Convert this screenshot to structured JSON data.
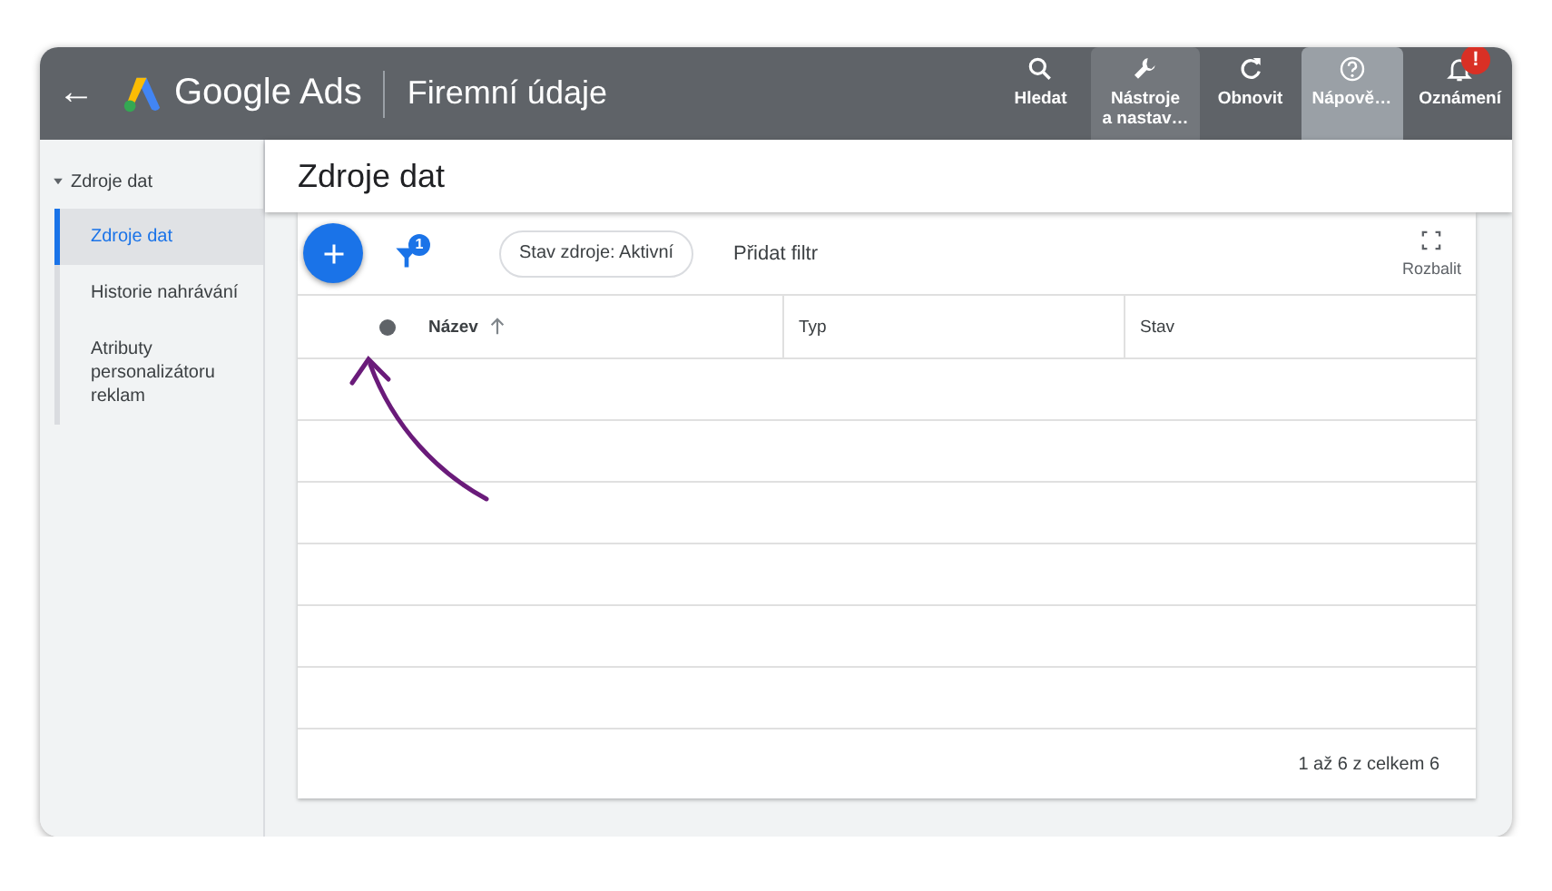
{
  "app_bar": {
    "back": "←",
    "product": "Google Ads",
    "section": "Firemní údaje",
    "actions": [
      {
        "label": "Hledat",
        "selected": false,
        "hovered": false
      },
      {
        "label": "Nástroje\na nastav…",
        "selected": false,
        "hovered": true
      },
      {
        "label": "Obnovit",
        "selected": false,
        "hovered": false
      },
      {
        "label": "Nápově…",
        "selected": true,
        "hovered": false
      },
      {
        "label": "Oznámení",
        "selected": false,
        "hovered": false,
        "badge": "!"
      }
    ]
  },
  "sidebar": {
    "group": {
      "label": "Zdroje dat",
      "expanded": true
    },
    "items": [
      {
        "label": "Zdroje dat",
        "selected": true
      },
      {
        "label": "Historie nahrávání",
        "selected": false
      },
      {
        "label": "Atributy personalizátoru reklam",
        "selected": false
      }
    ]
  },
  "page_title": "Zdroje dat",
  "toolbar": {
    "filter_count": "1",
    "chip": "Stav zdroje: Aktivní",
    "add_filter": "Přidat filtr",
    "expand": "Rozbalit"
  },
  "table": {
    "columns": [
      {
        "label": "Název",
        "sorted": true
      },
      {
        "label": "Typ",
        "sorted": false
      },
      {
        "label": "Stav",
        "sorted": false
      }
    ],
    "pagination": "1 až 6 z celkem 6"
  }
}
